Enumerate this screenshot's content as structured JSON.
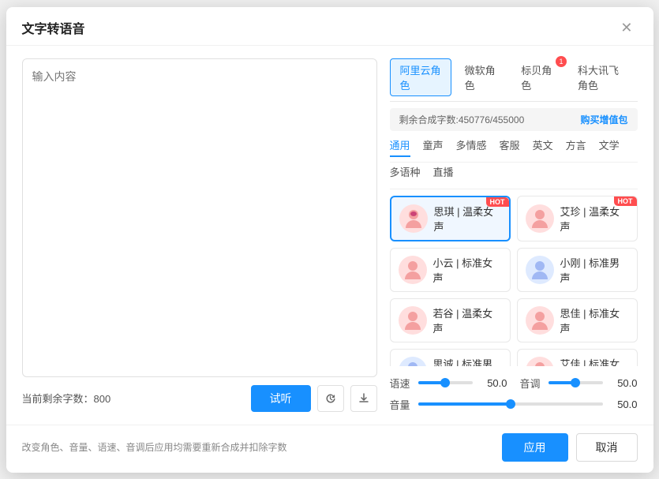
{
  "dialog": {
    "title": "文字转语音",
    "close_label": "✕"
  },
  "left": {
    "textarea_placeholder": "输入内容",
    "remaining_label": "当前剩余字数：",
    "remaining_count": "800",
    "btn_trial": "试听",
    "btn_history_icon": "↺",
    "btn_download_icon": "⬇"
  },
  "right": {
    "tabs": [
      {
        "id": "alibaba",
        "label": "阿里云角色",
        "active": true,
        "badge": null
      },
      {
        "id": "microsoft",
        "label": "微软角色",
        "active": false,
        "badge": null
      },
      {
        "id": "biaoyu",
        "label": "标贝角色",
        "active": false,
        "badge": "1"
      },
      {
        "id": "iflytek",
        "label": "科大讯飞角色",
        "active": false,
        "badge": null
      }
    ],
    "quota_text": "剩余合成字数:450776/455000",
    "quota_link": "购买增值包",
    "sub_tabs": [
      {
        "id": "general",
        "label": "通用",
        "active": true
      },
      {
        "id": "child",
        "label": "童声",
        "active": false
      },
      {
        "id": "emotion",
        "label": "多情感",
        "active": false
      },
      {
        "id": "service",
        "label": "客服",
        "active": false
      },
      {
        "id": "english",
        "label": "英文",
        "active": false
      },
      {
        "id": "dialect",
        "label": "方言",
        "active": false
      },
      {
        "id": "literature",
        "label": "文学",
        "active": false
      },
      {
        "id": "multilang",
        "label": "多语种",
        "active": false
      },
      {
        "id": "live",
        "label": "直播",
        "active": false
      }
    ],
    "voices": [
      {
        "id": "siqin",
        "name": "思琪 | 温柔女声",
        "gender": "female",
        "selected": true,
        "hot": true
      },
      {
        "id": "aizhen",
        "name": "艾珍 | 温柔女声",
        "gender": "female",
        "selected": false,
        "hot": true
      },
      {
        "id": "xiaoyun",
        "name": "小云 | 标准女声",
        "gender": "female",
        "selected": false,
        "hot": false
      },
      {
        "id": "xiaogang",
        "name": "小刚 | 标准男声",
        "gender": "male",
        "selected": false,
        "hot": false
      },
      {
        "id": "ruogu",
        "name": "若谷 | 温柔女声",
        "gender": "female",
        "selected": false,
        "hot": false
      },
      {
        "id": "sijia",
        "name": "思佳 | 标准女声",
        "gender": "female",
        "selected": false,
        "hot": false
      },
      {
        "id": "sicheng",
        "name": "思诚 | 标准男声",
        "gender": "male",
        "selected": false,
        "hot": false
      },
      {
        "id": "aijia",
        "name": "艾佳 | 标准女声",
        "gender": "female",
        "selected": false,
        "hot": false
      }
    ],
    "sliders": {
      "speed_label": "语速",
      "speed_value": "50.0",
      "pitch_label": "音调",
      "pitch_value": "50.0",
      "volume_label": "音量",
      "volume_value": "50.0"
    }
  },
  "footer": {
    "note": "改变角色、音量、语速、音调后应用均需要重新合成并扣除字数",
    "btn_apply": "应用",
    "btn_cancel": "取消"
  }
}
